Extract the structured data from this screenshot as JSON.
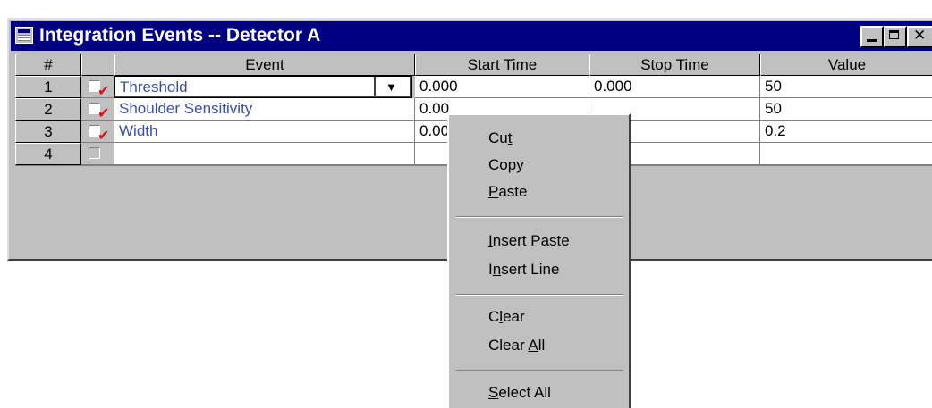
{
  "window": {
    "title": "Integration Events -- Detector A"
  },
  "grid": {
    "headers": {
      "num": "#",
      "event": "Event",
      "start": "Start Time",
      "stop": "Stop Time",
      "value": "Value"
    },
    "rows": [
      {
        "num": "1",
        "checked": true,
        "event": "Threshold",
        "start": "0.000",
        "stop": "0.000",
        "value": "50"
      },
      {
        "num": "2",
        "checked": true,
        "event": "Shoulder Sensitivity",
        "start": "0.00",
        "stop": "",
        "value": "50"
      },
      {
        "num": "3",
        "checked": true,
        "event": "Width",
        "start": "0.00",
        "stop": "",
        "value": "0.2"
      },
      {
        "num": "4",
        "checked": false,
        "event": "",
        "start": "",
        "stop": "",
        "value": ""
      }
    ]
  },
  "menu": {
    "items": [
      {
        "pre": "Cu",
        "key": "t",
        "post": ""
      },
      {
        "pre": "",
        "key": "C",
        "post": "opy"
      },
      {
        "pre": "",
        "key": "P",
        "post": "aste"
      },
      {
        "pre": "",
        "key": "I",
        "post": "nsert Paste"
      },
      {
        "pre": "I",
        "key": "n",
        "post": "sert Line"
      },
      {
        "pre": "C",
        "key": "l",
        "post": "ear"
      },
      {
        "pre": "Clear ",
        "key": "A",
        "post": "ll"
      },
      {
        "pre": "",
        "key": "S",
        "post": "elect All"
      }
    ]
  },
  "colors": {
    "title_bg": "#000080",
    "event_text": "#3a4fa8",
    "check": "#e01010",
    "face": "#c0c0c0"
  },
  "icons": {
    "checked": "check-icon",
    "dropdown": "chevron-down-icon"
  }
}
